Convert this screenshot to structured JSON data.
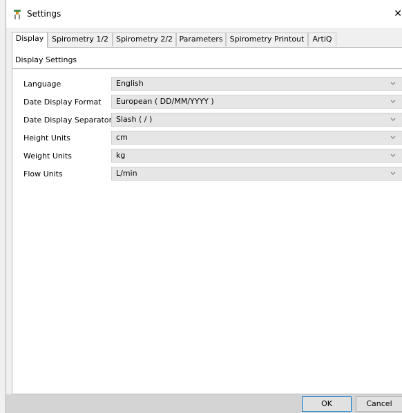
{
  "window": {
    "title": "Settings",
    "close_glyph": "✕",
    "icon": "app-icon"
  },
  "tabs": [
    {
      "label": "Display",
      "active": true
    },
    {
      "label": "Spirometry 1/2",
      "active": false
    },
    {
      "label": "Spirometry 2/2",
      "active": false
    },
    {
      "label": "Parameters",
      "active": false
    },
    {
      "label": "Spirometry Printout",
      "active": false
    },
    {
      "label": "ArtiQ",
      "active": false
    }
  ],
  "section": {
    "title": "Display Settings"
  },
  "settings": [
    {
      "label": "Language",
      "value": "English"
    },
    {
      "label": "Date Display Format",
      "value": "European ( DD/MM/YYYY )"
    },
    {
      "label": "Date Display Separator",
      "value": "Slash ( / )"
    },
    {
      "label": "Height Units",
      "value": "cm"
    },
    {
      "label": "Weight Units",
      "value": "kg"
    },
    {
      "label": "Flow Units",
      "value": "L/min"
    }
  ],
  "buttons": {
    "ok": "OK",
    "cancel": "Cancel"
  },
  "colors": {
    "focus_border": "#0078d7",
    "panel_bg": "#ffffff",
    "dialog_bg": "#f0f0f0"
  }
}
